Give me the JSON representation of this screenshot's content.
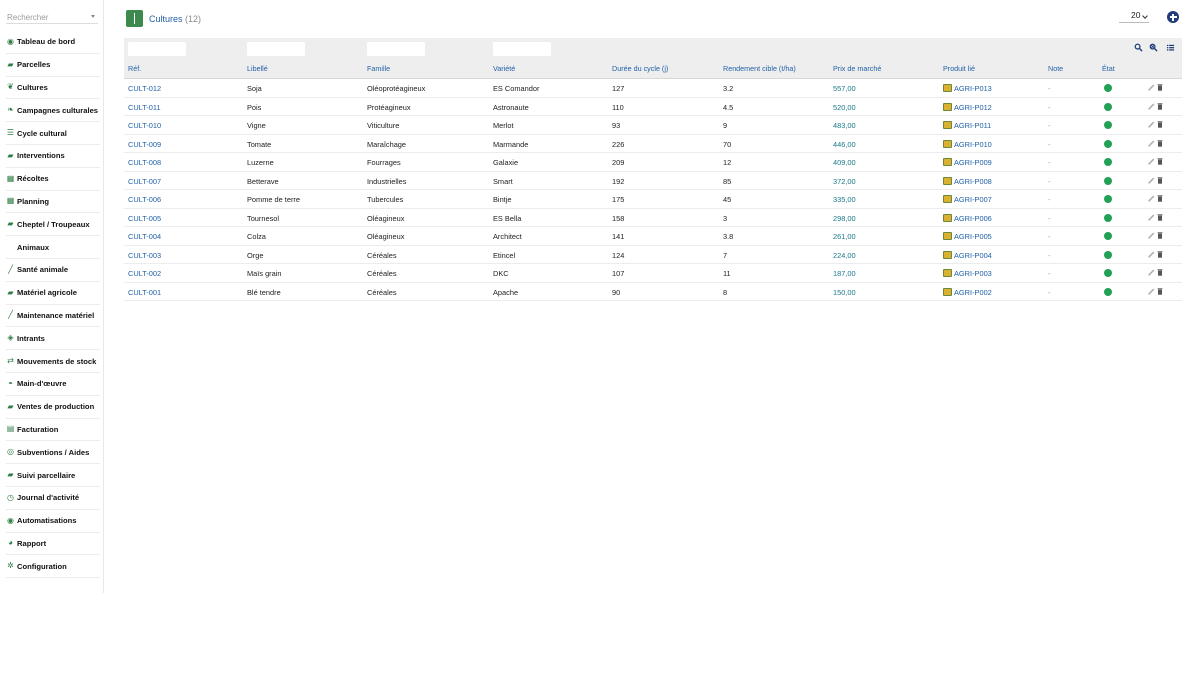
{
  "search": {
    "placeholder": "Rechercher"
  },
  "sidebar": {
    "items": [
      {
        "label": "Tableau de bord",
        "icon": "dashboard-icon",
        "glyph": "◉"
      },
      {
        "label": "Parcelles",
        "icon": "tractor-icon",
        "glyph": "▰"
      },
      {
        "label": "Cultures",
        "icon": "sprout-icon",
        "glyph": "❦"
      },
      {
        "label": "Campagnes culturales",
        "icon": "leaf-icon",
        "glyph": "❧"
      },
      {
        "label": "Cycle cultural",
        "icon": "list-icon",
        "glyph": "☰"
      },
      {
        "label": "Interventions",
        "icon": "tractor-icon",
        "glyph": "▰"
      },
      {
        "label": "Récoltes",
        "icon": "calendar-icon",
        "glyph": "▦"
      },
      {
        "label": "Planning",
        "icon": "calendar-icon",
        "glyph": "▦"
      },
      {
        "label": "Cheptel / Troupeaux",
        "icon": "cow-icon",
        "glyph": "▰"
      },
      {
        "label": "Animaux",
        "icon": "",
        "glyph": "",
        "sub": true
      },
      {
        "label": "Santé animale",
        "icon": "syringe-icon",
        "glyph": "╱"
      },
      {
        "label": "Matériel agricole",
        "icon": "tractor-icon",
        "glyph": "▰"
      },
      {
        "label": "Maintenance matériel",
        "icon": "wrench-icon",
        "glyph": "╱"
      },
      {
        "label": "Intrants",
        "icon": "flask-icon",
        "glyph": "◈"
      },
      {
        "label": "Mouvements de stock",
        "icon": "transfer-icon",
        "glyph": "⇄"
      },
      {
        "label": "Main-d'œuvre",
        "icon": "user-icon",
        "glyph": "◓"
      },
      {
        "label": "Ventes de production",
        "icon": "truck-icon",
        "glyph": "▰"
      },
      {
        "label": "Facturation",
        "icon": "invoice-icon",
        "glyph": "▤"
      },
      {
        "label": "Subventions / Aides",
        "icon": "award-icon",
        "glyph": "◎"
      },
      {
        "label": "Suivi parcellaire",
        "icon": "map-icon",
        "glyph": "▰"
      },
      {
        "label": "Journal d'activité",
        "icon": "history-icon",
        "glyph": "◷"
      },
      {
        "label": "Automatisations",
        "icon": "robot-icon",
        "glyph": "◉"
      },
      {
        "label": "Rapport",
        "icon": "report-icon",
        "glyph": "◕"
      },
      {
        "label": "Configuration",
        "icon": "gear-icon",
        "glyph": "✲"
      }
    ]
  },
  "header": {
    "title": "Cultures",
    "count": "(12)",
    "per_page": "20"
  },
  "table": {
    "columns": [
      "Réf.",
      "Libellé",
      "Famille",
      "Variété",
      "Durée du cycle (j)",
      "Rendement cible (t/ha)",
      "Prix de marché",
      "Produit lié",
      "Note",
      "État"
    ],
    "rows": [
      {
        "ref": "CULT-012",
        "label": "Soja",
        "family": "Oléoprotéagineux",
        "variety": "ES Comandor",
        "cycle": "127",
        "yield": "3.2",
        "price": "557,00",
        "product": "AGRI-P013",
        "note": "-"
      },
      {
        "ref": "CULT-011",
        "label": "Pois",
        "family": "Protéagineux",
        "variety": "Astronaute",
        "cycle": "110",
        "yield": "4.5",
        "price": "520,00",
        "product": "AGRI-P012",
        "note": "-"
      },
      {
        "ref": "CULT-010",
        "label": "Vigne",
        "family": "Viticulture",
        "variety": "Merlot",
        "cycle": "93",
        "yield": "9",
        "price": "483,00",
        "product": "AGRI-P011",
        "note": "-"
      },
      {
        "ref": "CULT-009",
        "label": "Tomate",
        "family": "Maraîchage",
        "variety": "Marmande",
        "cycle": "226",
        "yield": "70",
        "price": "446,00",
        "product": "AGRI-P010",
        "note": "-"
      },
      {
        "ref": "CULT-008",
        "label": "Luzerne",
        "family": "Fourrages",
        "variety": "Galaxie",
        "cycle": "209",
        "yield": "12",
        "price": "409,00",
        "product": "AGRI-P009",
        "note": "-"
      },
      {
        "ref": "CULT-007",
        "label": "Betterave",
        "family": "Industrielles",
        "variety": "Smart",
        "cycle": "192",
        "yield": "85",
        "price": "372,00",
        "product": "AGRI-P008",
        "note": "-"
      },
      {
        "ref": "CULT-006",
        "label": "Pomme de terre",
        "family": "Tubercules",
        "variety": "Bintje",
        "cycle": "175",
        "yield": "45",
        "price": "335,00",
        "product": "AGRI-P007",
        "note": "-"
      },
      {
        "ref": "CULT-005",
        "label": "Tournesol",
        "family": "Oléagineux",
        "variety": "ES Bella",
        "cycle": "158",
        "yield": "3",
        "price": "298,00",
        "product": "AGRI-P006",
        "note": "-"
      },
      {
        "ref": "CULT-004",
        "label": "Colza",
        "family": "Oléagineux",
        "variety": "Architect",
        "cycle": "141",
        "yield": "3.8",
        "price": "261,00",
        "product": "AGRI-P005",
        "note": "-"
      },
      {
        "ref": "CULT-003",
        "label": "Orge",
        "family": "Céréales",
        "variety": "Etincel",
        "cycle": "124",
        "yield": "7",
        "price": "224,00",
        "product": "AGRI-P004",
        "note": "-"
      },
      {
        "ref": "CULT-002",
        "label": "Maïs grain",
        "family": "Céréales",
        "variety": "DKC",
        "cycle": "107",
        "yield": "11",
        "price": "187,00",
        "product": "AGRI-P003",
        "note": "-"
      },
      {
        "ref": "CULT-001",
        "label": "Blé tendre",
        "family": "Céréales",
        "variety": "Apache",
        "cycle": "90",
        "yield": "8",
        "price": "150,00",
        "product": "AGRI-P002",
        "note": "-"
      }
    ]
  },
  "colors": {
    "accent": "#2261a8",
    "brand": "#3d8a4f",
    "status_active": "#22a056",
    "add_button": "#1f3d7a"
  }
}
